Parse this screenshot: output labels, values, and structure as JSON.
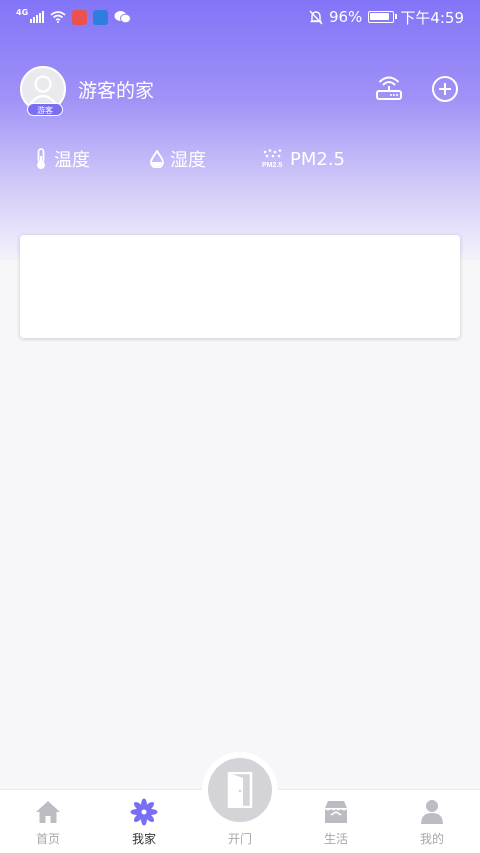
{
  "status_bar": {
    "network": "4G",
    "battery_percent": "96%",
    "time": "下午4:59"
  },
  "header": {
    "home_name": "游客的家",
    "avatar_badge": "游客"
  },
  "sensors": [
    {
      "label": "温度",
      "icon": "thermometer-icon"
    },
    {
      "label": "湿度",
      "icon": "water-drop-icon"
    },
    {
      "label": "PM2.5",
      "icon": "pm25-icon",
      "icon_text": "PM2.5"
    }
  ],
  "tabs": [
    {
      "label": "首页",
      "icon": "home-icon",
      "active": false
    },
    {
      "label": "我家",
      "icon": "flower-icon",
      "active": true
    },
    {
      "label": "开门",
      "icon": "door-icon",
      "active": false
    },
    {
      "label": "生活",
      "icon": "store-icon",
      "active": false
    },
    {
      "label": "我的",
      "icon": "user-icon",
      "active": false
    }
  ],
  "colors": {
    "accent": "#7a6ff2",
    "gradient_top": "#8274f7",
    "tab_inactive": "#a7a7ad"
  }
}
